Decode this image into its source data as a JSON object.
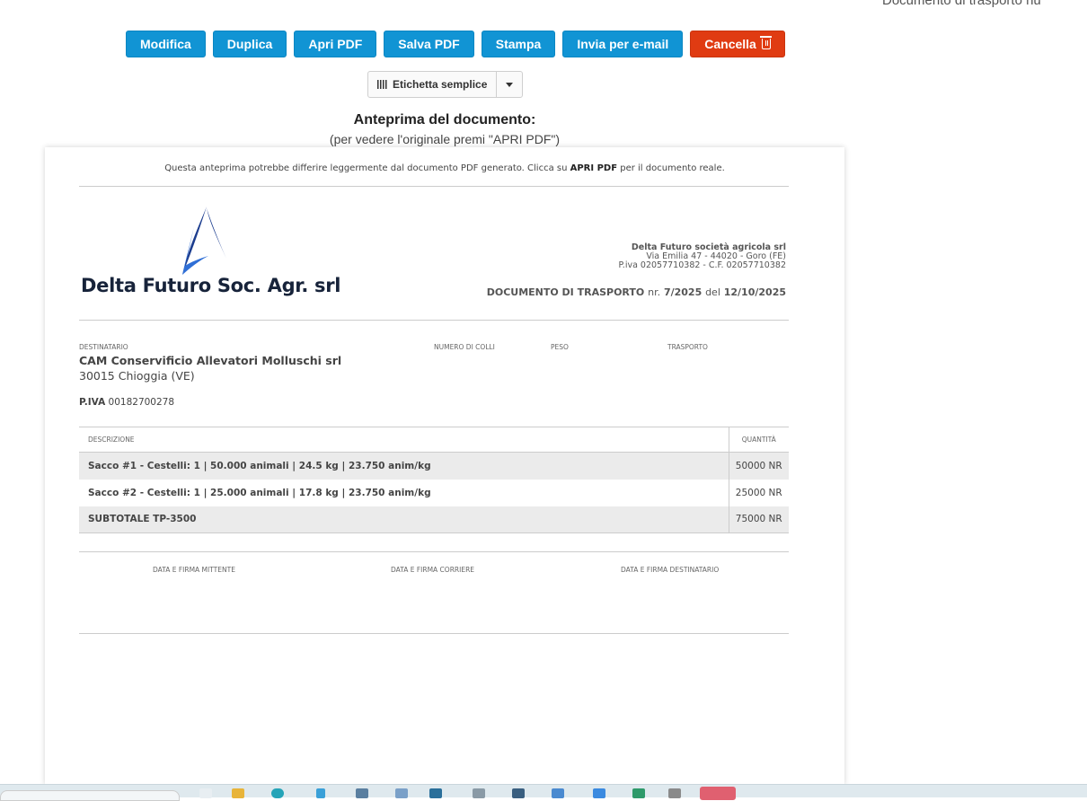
{
  "header": {
    "page_title_partial": "Documento di trasporto nu"
  },
  "toolbar": {
    "edit": "Modifica",
    "duplicate": "Duplica",
    "open_pdf": "Apri PDF",
    "save_pdf": "Salva PDF",
    "print": "Stampa",
    "email": "Invia per e-mail",
    "delete": "Cancella"
  },
  "label_button": {
    "label": "Etichetta semplice"
  },
  "preview": {
    "title": "Anteprima del documento:",
    "subtitle": "(per vedere l'originale premi \"APRI PDF\")"
  },
  "document": {
    "disclaimer_pre": "Questa anteprima potrebbe differire leggermente dal documento PDF generato. Clicca su ",
    "disclaimer_bold": "APRI PDF",
    "disclaimer_post": " per il documento reale.",
    "logo_text": "Delta Futuro Soc. Agr. srl",
    "company": {
      "name": "Delta Futuro società agricola srl",
      "address": "Via Emilia 47 - 44020 - Goro (FE)",
      "vat": "P.iva 02057710382 - C.F. 02057710382"
    },
    "doc_type": "DOCUMENTO DI TRASPORTO",
    "nr_label": "nr.",
    "nr_value": "7/2025",
    "date_label": "del",
    "date_value": "12/10/2025",
    "labels": {
      "recipient": "DESTINATARIO",
      "packages": "NUMERO DI COLLI",
      "weight": "PESO",
      "transport": "TRASPORTO"
    },
    "recipient": {
      "name": "CAM Conservificio Allevatori Molluschi srl",
      "city": "30015 Chioggia (VE)",
      "vat_label": "P.IVA",
      "vat_value": "00182700278"
    },
    "table": {
      "headers": {
        "description": "DESCRIZIONE",
        "quantity": "QUANTITÀ"
      },
      "rows": [
        {
          "description": "Sacco #1 - Cestelli: 1 | 50.000 animali | 24.5 kg | 23.750 anim/kg",
          "quantity": "50000 NR"
        },
        {
          "description": "Sacco #2 - Cestelli: 1 | 25.000 animali | 17.8 kg | 23.750 anim/kg",
          "quantity": "25000 NR"
        },
        {
          "description": "SUBTOTALE TP-3500",
          "quantity": "75000 NR"
        }
      ]
    },
    "signatures": {
      "sender": "DATA E FIRMA MITTENTE",
      "carrier": "DATA E FIRMA CORRIERE",
      "recipient": "DATA E FIRMA DESTINATARIO"
    }
  },
  "colors": {
    "primary": "#1194d4",
    "danger": "#e03b12",
    "logo": "#17233a"
  }
}
